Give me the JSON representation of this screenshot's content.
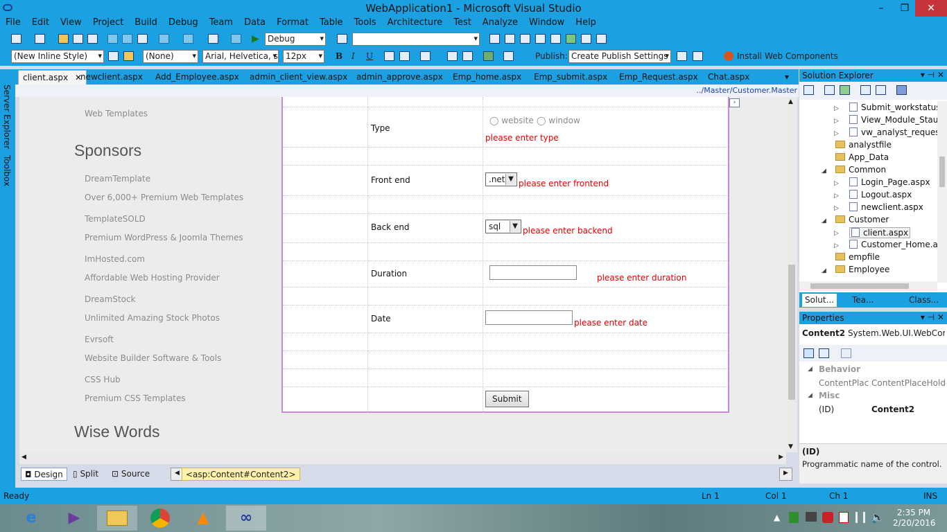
{
  "window": {
    "title": "WebApplication1 - Microsoft Visual Studio",
    "min": "–",
    "restore": "❐",
    "close": "✕"
  },
  "menu": [
    "File",
    "Edit",
    "View",
    "Project",
    "Build",
    "Debug",
    "Team",
    "Data",
    "Format",
    "Table",
    "Tools",
    "Architecture",
    "Test",
    "Analyze",
    "Window",
    "Help"
  ],
  "toolbar1": {
    "config": "Debug",
    "platform": ""
  },
  "toolbar2": {
    "style": "(New Inline Style)",
    "target": "(None)",
    "font": "Arial, Helvetica, sa",
    "size": "12px",
    "bold": "B",
    "italic": "I",
    "underline": "U",
    "publish_label": "Publish:",
    "publish_value": "Create Publish Settings",
    "install": "Install Web Components"
  },
  "side_tabs": {
    "server": "Server Explorer",
    "toolbox": "Toolbox"
  },
  "doc_tabs": [
    "client.aspx",
    "newclient.aspx",
    "Add_Employee.aspx",
    "admin_client_view.aspx",
    "admin_approve.aspx",
    "Emp_home.aspx",
    "Emp_submit.aspx",
    "Emp_Request.aspx",
    "Chat.aspx"
  ],
  "master_path": "../Master/Customer.Master",
  "page": {
    "web_templates": "Web Templates",
    "sponsors_heading": "Sponsors",
    "sponsors": [
      {
        "name": "DreamTemplate",
        "desc": "Over 6,000+ Premium Web Templates"
      },
      {
        "name": "TemplateSOLD",
        "desc": "Premium WordPress & Joomla Themes"
      },
      {
        "name": "ImHosted.com",
        "desc": "Affordable Web Hosting Provider"
      },
      {
        "name": "DreamStock",
        "desc": "Unlimited Amazing Stock Photos"
      },
      {
        "name": "Evrsoft",
        "desc": "Website Builder Software & Tools"
      },
      {
        "name": "CSS Hub",
        "desc": "Premium CSS Templates"
      }
    ],
    "wise_words": "Wise Words"
  },
  "form": {
    "type_label": "Type",
    "type_opt1": "website",
    "type_opt2": "window",
    "type_err": "please enter type",
    "frontend_label": "Front end",
    "frontend_value": ".net",
    "frontend_err": "please enter frontend",
    "backend_label": "Back end",
    "backend_value": "sql",
    "backend_err": "please enter backend",
    "duration_label": "Duration",
    "duration_err": "please enter duration",
    "date_label": "Date",
    "date_err": "please enter date",
    "submit": "Submit"
  },
  "view_tabs": {
    "design": "Design",
    "split": "Split",
    "source": "Source",
    "tag": "<asp:Content#Content2>"
  },
  "solution_explorer": {
    "title": "Solution Explorer",
    "items": [
      {
        "label": "Submit_workstatus",
        "kind": "page",
        "arrow": "▷"
      },
      {
        "label": "View_Module_Stau",
        "kind": "page",
        "arrow": "▷"
      },
      {
        "label": "vw_analyst_reques",
        "kind": "page",
        "arrow": "▷"
      },
      {
        "label": "analystfile",
        "kind": "folder",
        "arrow": ""
      },
      {
        "label": "App_Data",
        "kind": "folder",
        "arrow": ""
      },
      {
        "label": "Common",
        "kind": "folder",
        "arrow": "◢"
      },
      {
        "label": "Login_Page.aspx",
        "kind": "page",
        "arrow": "▷"
      },
      {
        "label": "Logout.aspx",
        "kind": "page",
        "arrow": "▷"
      },
      {
        "label": "newclient.aspx",
        "kind": "page",
        "arrow": "▷"
      },
      {
        "label": "Customer",
        "kind": "folder",
        "arrow": "◢"
      },
      {
        "label": "client.aspx",
        "kind": "page",
        "arrow": "▷"
      },
      {
        "label": "Customer_Home.a",
        "kind": "page",
        "arrow": "▷"
      },
      {
        "label": "empfile",
        "kind": "folder",
        "arrow": ""
      },
      {
        "label": "Employee",
        "kind": "folder",
        "arrow": "◢"
      }
    ],
    "bottom_tabs": [
      "Solut...",
      "Tea...",
      "Class..."
    ]
  },
  "properties": {
    "title": "Properties",
    "object": "Content2",
    "object_type": "System.Web.UI.WebCor",
    "cat_behavior": "Behavior",
    "cp_name": "ContentPlace",
    "cp_value": "ContentPlaceHolde",
    "cat_misc": "Misc",
    "id_name": "(ID)",
    "id_value": "Content2",
    "desc_title": "(ID)",
    "desc_text": "Programmatic name of the control."
  },
  "status": {
    "ready": "Ready",
    "ln": "Ln 1",
    "col": "Col 1",
    "ch": "Ch 1",
    "ins": "INS"
  },
  "clock": {
    "time": "2:35 PM",
    "date": "2/20/2016"
  }
}
